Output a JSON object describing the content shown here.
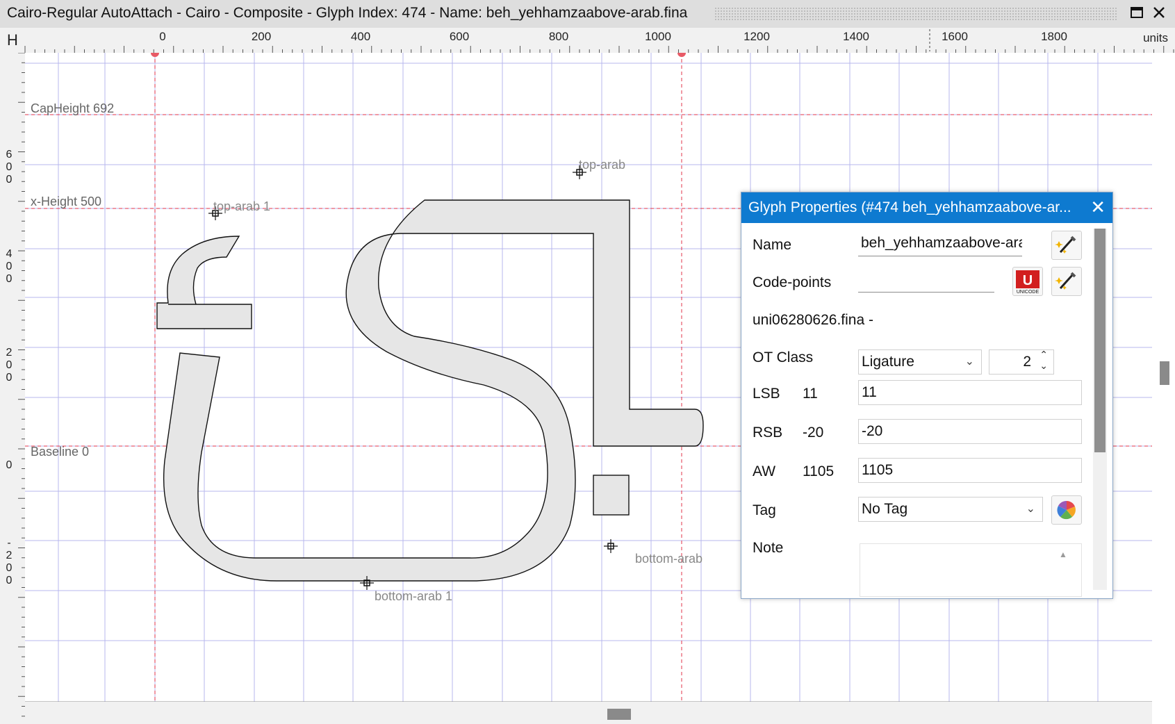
{
  "window": {
    "title": "Cairo-Regular AutoAttach - Cairo - Composite - Glyph Index: 474 - Name: beh_yehhamzaabove-arab.fina"
  },
  "ruler": {
    "corner": "H",
    "units": "units",
    "x_labels": [
      "0",
      "200",
      "400",
      "600",
      "800",
      "1000",
      "1200",
      "1400",
      "1600",
      "1800"
    ],
    "y_labels": [
      "600",
      "400",
      "200",
      "0",
      "-200"
    ]
  },
  "guides": {
    "capheight": "CapHeight 692",
    "xheight": "x-Height 500",
    "baseline": "Baseline 0"
  },
  "anchors": [
    {
      "id": "top-arab",
      "label": "top-arab"
    },
    {
      "id": "top-arab-1",
      "label": "top-arab 1"
    },
    {
      "id": "bottom-arab",
      "label": "bottom-arab"
    },
    {
      "id": "bottom-arab-1",
      "label": "bottom-arab 1"
    }
  ],
  "panel": {
    "title": "Glyph Properties (#474 beh_yehhamzaabove-ar...",
    "close_glyph": "✕",
    "name_label": "Name",
    "name_value": "beh_yehhamzaabove-arab.",
    "codepoints_label": "Code-points",
    "codepoints_value": "",
    "derived_name": "uni06280626.fina -",
    "otclass_label": "OT Class",
    "otclass_value": "Ligature",
    "otclass_number": "2",
    "lsb_label": "LSB",
    "lsb_value": "11",
    "lsb_field": "11",
    "rsb_label": "RSB",
    "rsb_value": "-20",
    "rsb_field": "-20",
    "aw_label": "AW",
    "aw_value": "1105",
    "aw_field": "1105",
    "tag_label": "Tag",
    "tag_value": "No Tag",
    "note_label": "Note",
    "unicode_badge": "UNICODE"
  },
  "colors": {
    "grid": "#b7b7ee",
    "guide": "#e0334a",
    "glyph_fill": "#e6e6e6",
    "accent": "#0e7ad0"
  }
}
